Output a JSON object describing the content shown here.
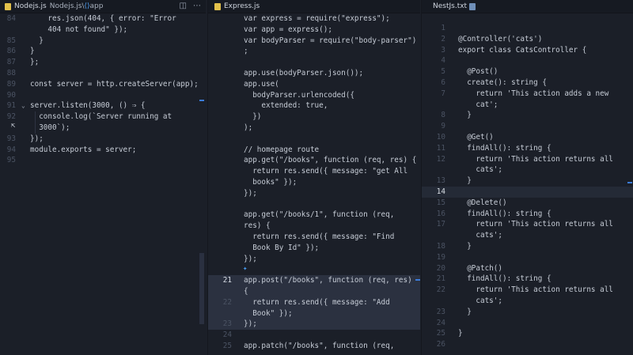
{
  "left_pane": {
    "tab": {
      "title": "Nodejs.js",
      "crumb_file": "Nodejs.js",
      "crumb_sep": "\\",
      "crumb_symbol": "app",
      "symbol_icon": "variable-icon"
    },
    "actions": [
      "split-editor-icon",
      "more-icon"
    ],
    "lines": [
      {
        "n": "84",
        "text": "    res.json(404, { error: \"Error"
      },
      {
        "n": "",
        "text": "    404 not found\" });"
      },
      {
        "n": "85",
        "text": "  }"
      },
      {
        "n": "86",
        "text": "}"
      },
      {
        "n": "87",
        "text": "};"
      },
      {
        "n": "88",
        "text": ""
      },
      {
        "n": "89",
        "text": "const server = http.createServer(app);"
      },
      {
        "n": "90",
        "text": ""
      },
      {
        "n": "91",
        "text": "server.listen(3000, () ⇒ {"
      },
      {
        "n": "92",
        "text": "  console.log(`Server running at"
      },
      {
        "n": "",
        "text": "  3000`);"
      },
      {
        "n": "93",
        "text": "});"
      },
      {
        "n": "94",
        "text": "module.exports = server;"
      },
      {
        "n": "95",
        "text": ""
      }
    ]
  },
  "mid_pane": {
    "tab": {
      "title": "Express.js"
    },
    "lines": [
      {
        "n": "",
        "text": "var express = require(\"express\");"
      },
      {
        "n": "",
        "text": "var app = express();"
      },
      {
        "n": "",
        "text": "var bodyParser = require(\"body-parser\")"
      },
      {
        "n": "",
        "text": ";"
      },
      {
        "n": "",
        "text": ""
      },
      {
        "n": "",
        "text": "app.use(bodyParser.json());"
      },
      {
        "n": "",
        "text": "app.use("
      },
      {
        "n": "",
        "text": "  bodyParser.urlencoded({"
      },
      {
        "n": "",
        "text": "    extended: true,"
      },
      {
        "n": "",
        "text": "  })"
      },
      {
        "n": "",
        "text": ");"
      },
      {
        "n": "",
        "text": ""
      },
      {
        "n": "",
        "text": "// homepage route"
      },
      {
        "n": "",
        "text": "app.get(\"/books\", function (req, res) {"
      },
      {
        "n": "",
        "text": "  return res.send({ message: \"get All"
      },
      {
        "n": "",
        "text": "  books\" });"
      },
      {
        "n": "",
        "text": "});"
      },
      {
        "n": "",
        "text": ""
      },
      {
        "n": "",
        "text": "app.get(\"/books/1\", function (req,"
      },
      {
        "n": "",
        "text": "res) {"
      },
      {
        "n": "",
        "text": "  return res.send({ message: \"Find"
      },
      {
        "n": "",
        "text": "  Book By Id\" });"
      },
      {
        "n": "",
        "text": "});"
      },
      {
        "n": "",
        "text": ""
      },
      {
        "n": "21",
        "text": "app.post(\"/books\", function (req, res)"
      },
      {
        "n": "",
        "text": "{"
      },
      {
        "n": "22",
        "text": "  return res.send({ message: \"Add"
      },
      {
        "n": "",
        "text": "  Book\" });"
      },
      {
        "n": "23",
        "text": "});"
      },
      {
        "n": "24",
        "text": ""
      },
      {
        "n": "25",
        "text": "app.patch(\"/books\", function (req,"
      }
    ]
  },
  "right_pane": {
    "tab": {
      "title": "NestJs.txt"
    },
    "lines": [
      {
        "n": "1",
        "text": ""
      },
      {
        "n": "2",
        "text": "@Controller('cats')"
      },
      {
        "n": "3",
        "text": "export class CatsController {"
      },
      {
        "n": "4",
        "text": ""
      },
      {
        "n": "5",
        "text": "  @Post()"
      },
      {
        "n": "6",
        "text": "  create(): string {"
      },
      {
        "n": "7",
        "text": "    return 'This action adds a new"
      },
      {
        "n": "",
        "text": "    cat';"
      },
      {
        "n": "8",
        "text": "  }"
      },
      {
        "n": "9",
        "text": ""
      },
      {
        "n": "10",
        "text": "  @Get()"
      },
      {
        "n": "11",
        "text": "  findAll(): string {"
      },
      {
        "n": "12",
        "text": "    return 'This action returns all"
      },
      {
        "n": "",
        "text": "    cats';"
      },
      {
        "n": "13",
        "text": "  }"
      },
      {
        "n": "14",
        "text": ""
      },
      {
        "n": "15",
        "text": "  @Delete()"
      },
      {
        "n": "16",
        "text": "  findAll(): string {"
      },
      {
        "n": "17",
        "text": "    return 'This action returns all"
      },
      {
        "n": "",
        "text": "    cats';"
      },
      {
        "n": "18",
        "text": "  }"
      },
      {
        "n": "19",
        "text": ""
      },
      {
        "n": "20",
        "text": "  @Patch()"
      },
      {
        "n": "21",
        "text": "  findAll(): string {"
      },
      {
        "n": "22",
        "text": "    return 'This action returns all"
      },
      {
        "n": "",
        "text": "    cats';"
      },
      {
        "n": "23",
        "text": "  }"
      },
      {
        "n": "24",
        "text": ""
      },
      {
        "n": "25",
        "text": "}"
      },
      {
        "n": "26",
        "text": ""
      }
    ]
  },
  "colors": {
    "editor_bg": "#1b1f28",
    "keyword": "#c792ea",
    "string": "#c3e88d",
    "function": "#82aaff",
    "accent_blue": "#3b7bd9"
  }
}
